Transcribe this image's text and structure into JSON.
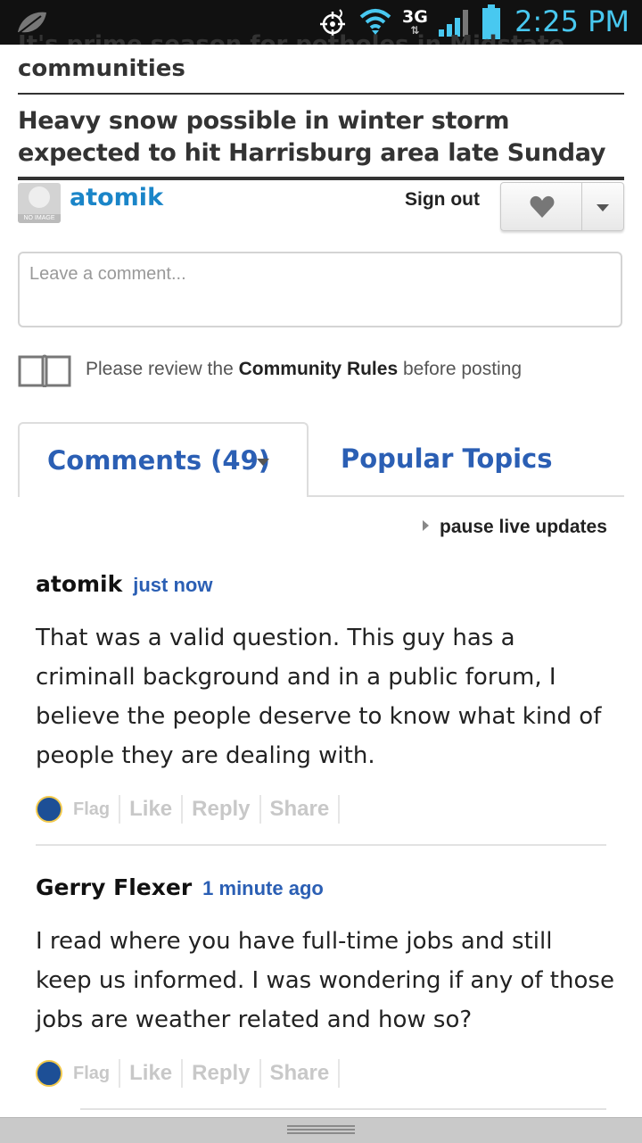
{
  "status_bar": {
    "network": "3G",
    "time": "2:25 PM",
    "accent_color": "#48c8f0"
  },
  "articles": {
    "cut_off_headline": "It's prime season for potholes in Midstate",
    "headline_1_tail": "communities",
    "headline_2": "Heavy snow possible in winter storm expected to hit Harrisburg area late Sunday"
  },
  "user": {
    "avatar_label": "NO IMAGE",
    "username": "atomik",
    "sign_out": "Sign out"
  },
  "comment_box": {
    "placeholder": "Leave a comment..."
  },
  "rules_notice": {
    "prefix": "Please review the",
    "link": "Community Rules",
    "suffix": "before posting"
  },
  "tabs": {
    "comments": "Comments (49)",
    "popular": "Popular Topics"
  },
  "pause_updates": "pause live updates",
  "comments": [
    {
      "author": "atomik",
      "time": "just now",
      "body": "That was a valid question. This guy has a criminall background and in a public forum, I believe the people deserve to know what kind of people they are dealing with.",
      "actions": {
        "flag": "Flag",
        "like": "Like",
        "reply": "Reply",
        "share": "Share"
      }
    },
    {
      "author": "Gerry Flexer",
      "time": "1 minute ago",
      "body": "I read where you have full-time jobs and still keep us informed. I was wondering if any of those jobs are weather related and how so?",
      "actions": {
        "flag": "Flag",
        "like": "Like",
        "reply": "Reply",
        "share": "Share"
      }
    }
  ],
  "colors": {
    "link_blue": "#2b5fb4",
    "username_blue": "#1a85c8"
  },
  "icons": [
    "leaf-icon",
    "gps-icon",
    "wifi-icon",
    "signal-icon",
    "battery-icon",
    "heart-icon",
    "chevron-down-icon",
    "book-icon",
    "play-icon",
    "flag-avatar-icon"
  ]
}
